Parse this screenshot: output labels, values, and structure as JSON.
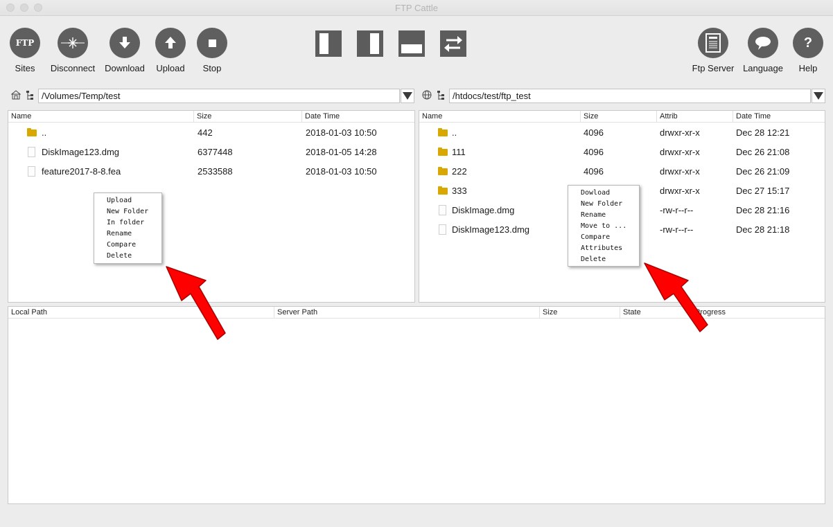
{
  "window": {
    "title": "FTP Cattle"
  },
  "toolbar": {
    "sites": {
      "label": "Sites",
      "icon": "ftp-icon",
      "glyph": "FTP"
    },
    "disconnect": {
      "label": "Disconnect",
      "icon": "disconnect-icon"
    },
    "download": {
      "label": "Download",
      "icon": "download-arrow-icon"
    },
    "upload": {
      "label": "Upload",
      "icon": "upload-arrow-icon"
    },
    "stop": {
      "label": "Stop",
      "icon": "stop-icon"
    },
    "layouts": [
      "layout-left-panel-icon",
      "layout-right-panel-icon",
      "layout-bottom-panel-icon",
      "swap-panels-icon"
    ],
    "ftp_server": {
      "label": "Ftp Server",
      "icon": "server-icon"
    },
    "language": {
      "label": "Language",
      "icon": "speech-bubble-icon"
    },
    "help": {
      "label": "Help",
      "icon": "help-icon",
      "glyph": "?"
    }
  },
  "local": {
    "path": "/Volumes/Temp/test",
    "columns": [
      "Name",
      "Size",
      "Date Time"
    ],
    "rows": [
      {
        "type": "folder",
        "name": "..",
        "size": "442",
        "date": "2018-01-03 10:50"
      },
      {
        "type": "file",
        "name": "DiskImage123.dmg",
        "size": "6377448",
        "date": "2018-01-05 14:28"
      },
      {
        "type": "file",
        "name": "feature2017-8-8.fea",
        "size": "2533588",
        "date": "2018-01-03 10:50"
      }
    ],
    "context_menu": [
      "Upload",
      "New Folder",
      "In folder",
      "Rename",
      "Compare",
      "Delete"
    ]
  },
  "remote": {
    "path": "/htdocs/test/ftp_test",
    "columns": [
      "Name",
      "Size",
      "Attrib",
      "Date Time"
    ],
    "rows": [
      {
        "type": "folder",
        "name": "..",
        "size": "4096",
        "attrib": "drwxr-xr-x",
        "date": "Dec 28 12:21"
      },
      {
        "type": "folder",
        "name": "111",
        "size": "4096",
        "attrib": "drwxr-xr-x",
        "date": "Dec 26 21:08"
      },
      {
        "type": "folder",
        "name": "222",
        "size": "4096",
        "attrib": "drwxr-xr-x",
        "date": "Dec 26 21:09"
      },
      {
        "type": "folder",
        "name": "333",
        "size": "",
        "attrib": "drwxr-xr-x",
        "date": "Dec 27 15:17"
      },
      {
        "type": "file",
        "name": "DiskImage.dmg",
        "size": "",
        "attrib": "-rw-r--r--",
        "date": "Dec 28 21:16"
      },
      {
        "type": "file",
        "name": "DiskImage123.dmg",
        "size": "",
        "attrib": "-rw-r--r--",
        "date": "Dec 28 21:18"
      }
    ],
    "context_menu": [
      "Dowload",
      "New Folder",
      "Rename",
      "Move to ...",
      "Compare",
      "Attributes",
      "Delete"
    ]
  },
  "transfer": {
    "columns": [
      "Local Path",
      "Server Path",
      "Size",
      "State",
      "Progress"
    ]
  },
  "colors": {
    "icon_gray": "#5f5f5f",
    "annotation_arrow": "#ff0000",
    "folder": "#d8a800"
  }
}
